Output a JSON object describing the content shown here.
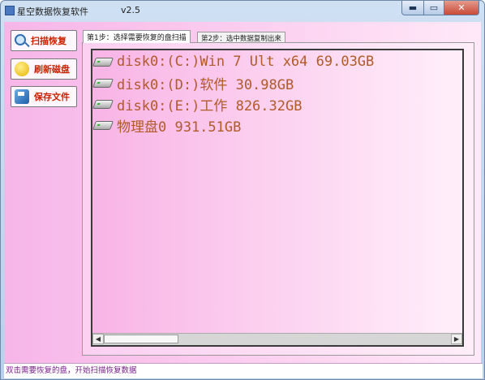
{
  "window": {
    "title": "星空数据恢复软件",
    "version": "v2.5",
    "controls": {
      "minimize": "▬",
      "maximize": "▭",
      "close": "✕"
    }
  },
  "sidebar": {
    "buttons": [
      {
        "label": "扫描恢复",
        "icon": "magnifier-icon"
      },
      {
        "label": "刷新磁盘",
        "icon": "refresh-disk-icon"
      },
      {
        "label": "保存文件",
        "icon": "save-file-icon"
      }
    ]
  },
  "tabs": [
    {
      "label": "第1步：选择需要恢复的盘扫描",
      "active": true
    },
    {
      "label": "第2步：选中数据复制出来",
      "active": false
    }
  ],
  "drives": [
    {
      "label": "disk0:(C:)Win 7 Ult x64 69.03GB"
    },
    {
      "label": "disk0:(D:)软件 30.98GB"
    },
    {
      "label": "disk0:(E:)工作 826.32GB"
    },
    {
      "label": "物理盘0 931.51GB"
    }
  ],
  "scrollbar": {
    "left_arrow": "◀",
    "right_arrow": "▶"
  },
  "status": {
    "text": "双击需要恢复的盘，开始扫描恢复数据"
  },
  "colors": {
    "client_bg": "#f8b4e6",
    "drive_text": "#b25a28",
    "side_label": "#cc2200",
    "status_text": "#7a1f8a"
  }
}
